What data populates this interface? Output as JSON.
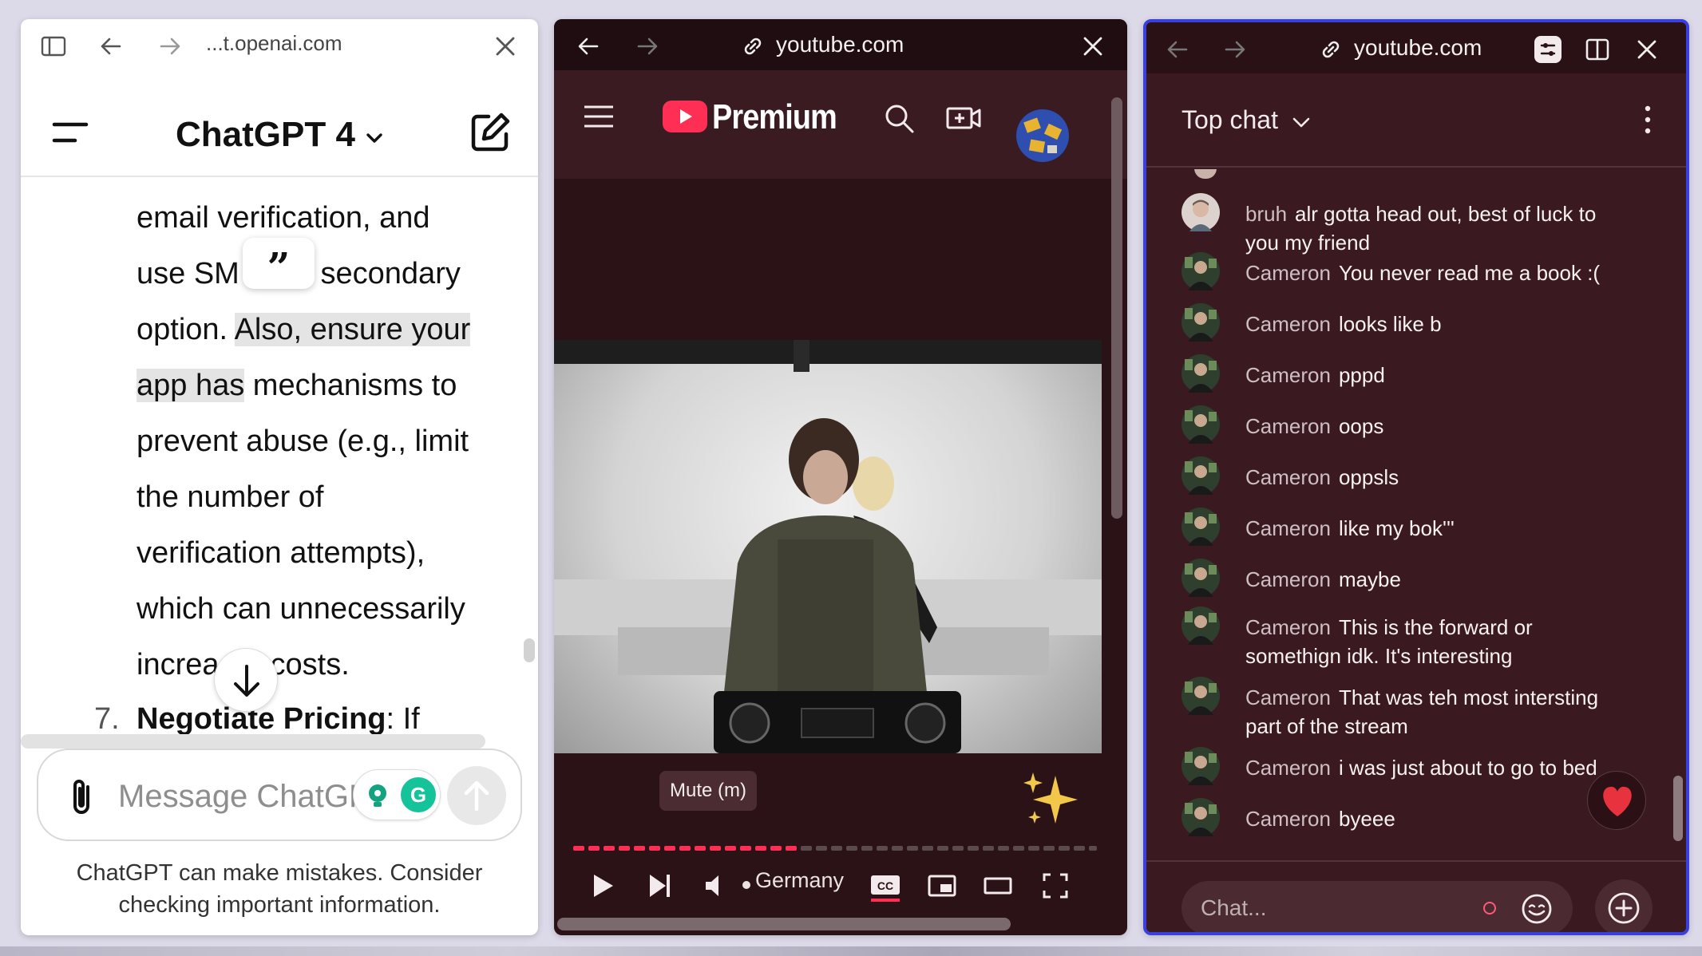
{
  "chatgpt": {
    "url": "...t.openai.com",
    "title": "ChatGPT 4",
    "lines": [
      "email verification, and",
      "use SM",
      "a secondary",
      "option. ",
      "Also, ensure your",
      "app has",
      " mechanisms to",
      "prevent abuse (e.g., limit",
      "the number of",
      "verification attempts),",
      "which can unnecessarily",
      "increa",
      "costs."
    ],
    "list_number": "7.",
    "list_bold": "Negotiate Pricing",
    "list_rest": ": If",
    "composer_placeholder": "Message ChatGPT",
    "disclaimer_line1": "ChatGPT can make mistakes. Consider",
    "disclaimer_line2": "checking important information."
  },
  "youtube": {
    "url": "youtube.com",
    "brand": "Premium",
    "mute_tooltip": "Mute (m)",
    "location_label": "Germany",
    "progress_played_fraction": 0.41,
    "accent": "#ff2e54"
  },
  "chat": {
    "url": "youtube.com",
    "mode_label": "Top chat",
    "input_placeholder": "Chat...",
    "messages": [
      {
        "name": "bruh",
        "text": "alr gotta head out, best of luck to you my friend"
      },
      {
        "name": "Cameron",
        "text": "You never read me a book :("
      },
      {
        "name": "Cameron",
        "text": "looks like b"
      },
      {
        "name": "Cameron",
        "text": "pppd"
      },
      {
        "name": "Cameron",
        "text": "oops"
      },
      {
        "name": "Cameron",
        "text": "oppsls"
      },
      {
        "name": "Cameron",
        "text": "like my bok'''"
      },
      {
        "name": "Cameron",
        "text": "maybe"
      },
      {
        "name": "Cameron",
        "text": "This is the forward or somethign idk. It's interesting"
      },
      {
        "name": "Cameron",
        "text": "That was teh most intersting part of the stream"
      },
      {
        "name": "Cameron",
        "text": "i was just about to go to bed"
      },
      {
        "name": "Cameron",
        "text": "byeee"
      }
    ],
    "border_accent": "#3a3fe0"
  }
}
